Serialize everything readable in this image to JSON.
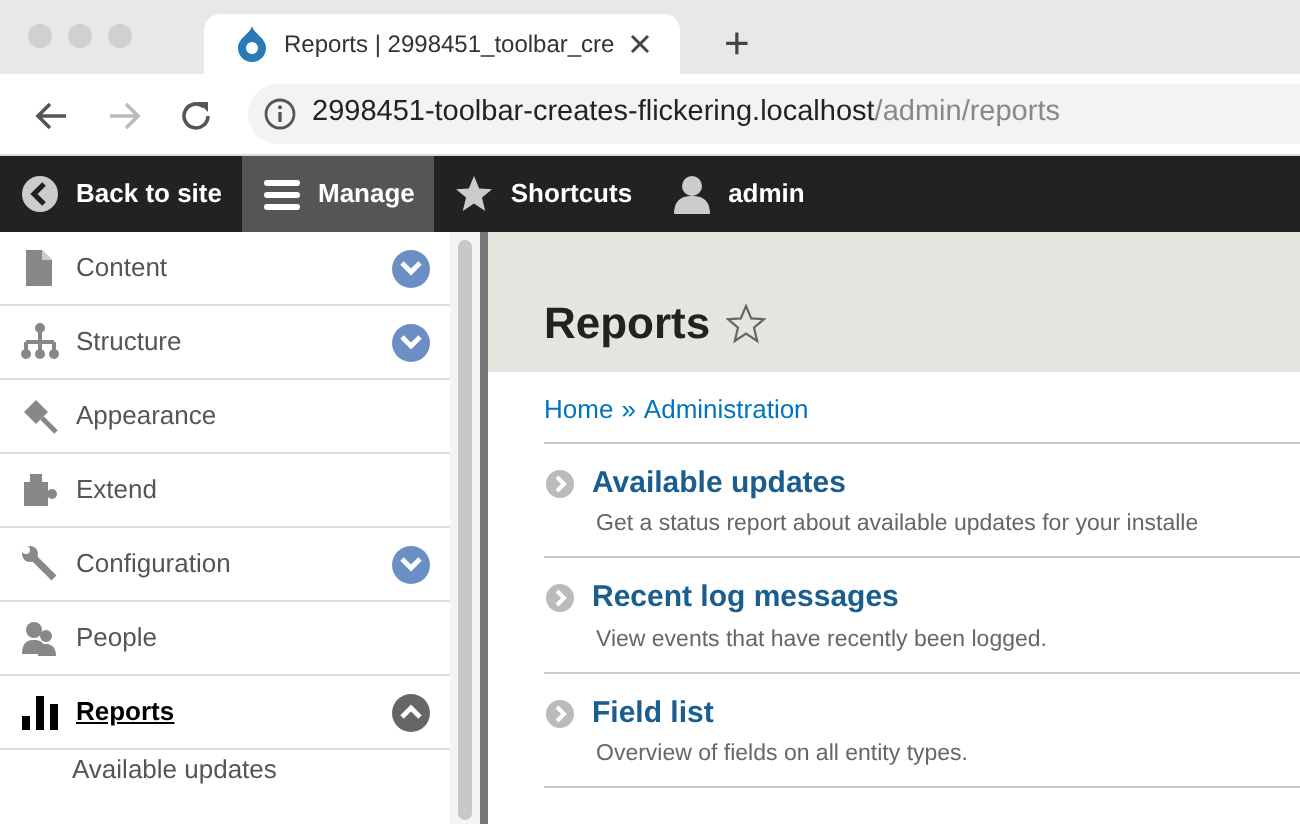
{
  "browser": {
    "tab": {
      "title": "Reports | 2998451_toolbar_cre"
    },
    "new_tab": "+",
    "nav": {
      "back_disabled": false,
      "forward_disabled": true
    },
    "url": {
      "host": "2998451-toolbar-creates-flickering.localhost",
      "path": "/admin/reports"
    }
  },
  "toolbar": {
    "items": [
      {
        "label": "Back to site",
        "kind": "back",
        "selected": false
      },
      {
        "label": "Manage",
        "kind": "menu",
        "selected": true
      },
      {
        "label": "Shortcuts",
        "kind": "star",
        "selected": false
      },
      {
        "label": "admin",
        "kind": "user",
        "selected": false
      }
    ]
  },
  "sidebar": {
    "items": [
      {
        "label": "Content",
        "kind": "content",
        "selected": false,
        "expanded": false
      },
      {
        "label": "Structure",
        "kind": "structure",
        "selected": false,
        "expanded": false
      },
      {
        "label": "Appearance",
        "kind": "appearance",
        "selected": false
      },
      {
        "label": "Extend",
        "kind": "extend",
        "selected": false
      },
      {
        "label": "Configuration",
        "kind": "configuration",
        "selected": false,
        "expanded": false
      },
      {
        "label": "People",
        "kind": "people",
        "selected": false
      },
      {
        "label": "Reports",
        "kind": "reports",
        "selected": true,
        "expanded": true,
        "children": [
          {
            "label": "Available updates"
          }
        ]
      }
    ]
  },
  "page": {
    "title": "Reports",
    "breadcrumb": [
      {
        "label": "Home"
      },
      {
        "label": "Administration"
      }
    ],
    "breadcrumb_separator": "»",
    "reports": [
      {
        "title": "Available updates",
        "description": "Get a status report about available updates for your installe"
      },
      {
        "title": "Recent log messages",
        "description": "View events that have recently been logged."
      },
      {
        "title": "Field list",
        "description": "Overview of fields on all entity types."
      }
    ]
  }
}
